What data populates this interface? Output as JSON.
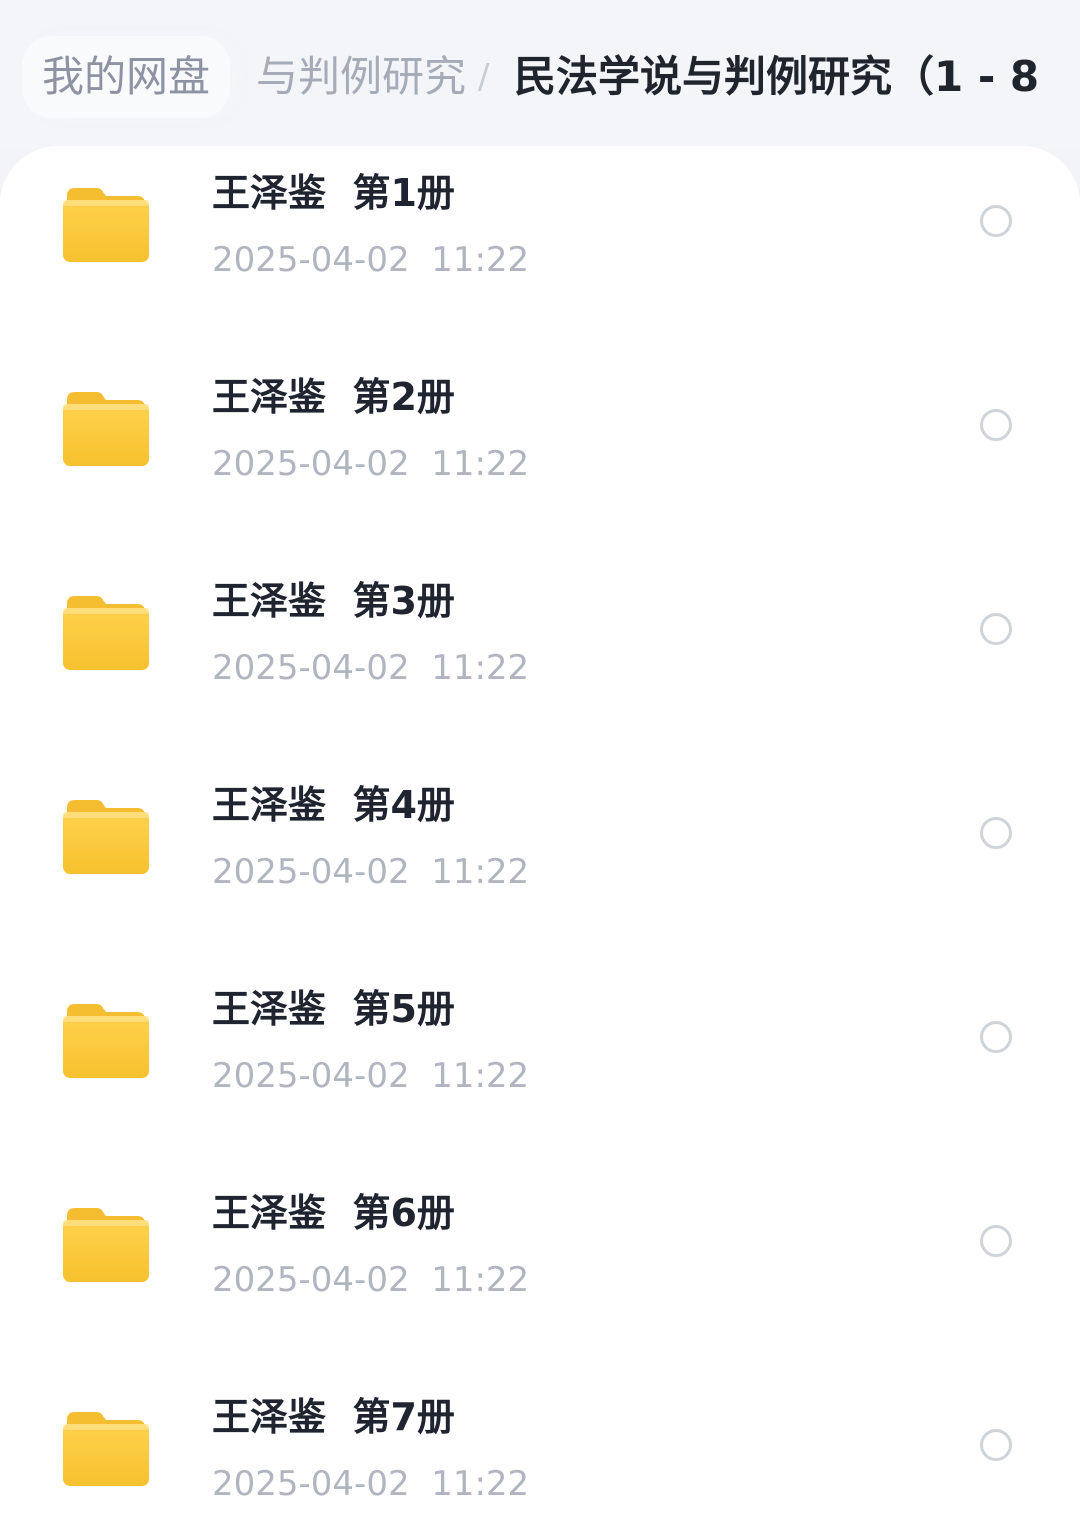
{
  "breadcrumb": {
    "root": "我的网盘",
    "middle": "与判例研究",
    "separator": "/",
    "current": "民法学说与判例研究（1 - 8"
  },
  "files": [
    {
      "name": "王泽鉴  第1册",
      "date": "2025-04-02  11:22"
    },
    {
      "name": "王泽鉴  第2册",
      "date": "2025-04-02  11:22"
    },
    {
      "name": "王泽鉴  第3册",
      "date": "2025-04-02  11:22"
    },
    {
      "name": "王泽鉴  第4册",
      "date": "2025-04-02  11:22"
    },
    {
      "name": "王泽鉴  第5册",
      "date": "2025-04-02  11:22"
    },
    {
      "name": "王泽鉴  第6册",
      "date": "2025-04-02  11:22"
    },
    {
      "name": "王泽鉴  第7册",
      "date": "2025-04-02  11:22"
    }
  ],
  "icons": {
    "folder": "folder-icon",
    "select": "select-circle"
  },
  "colors": {
    "folder_top": "#ffd24d",
    "folder_bottom": "#f6c12e",
    "title_text": "#1f2430",
    "meta_text": "#b0b5c0"
  }
}
